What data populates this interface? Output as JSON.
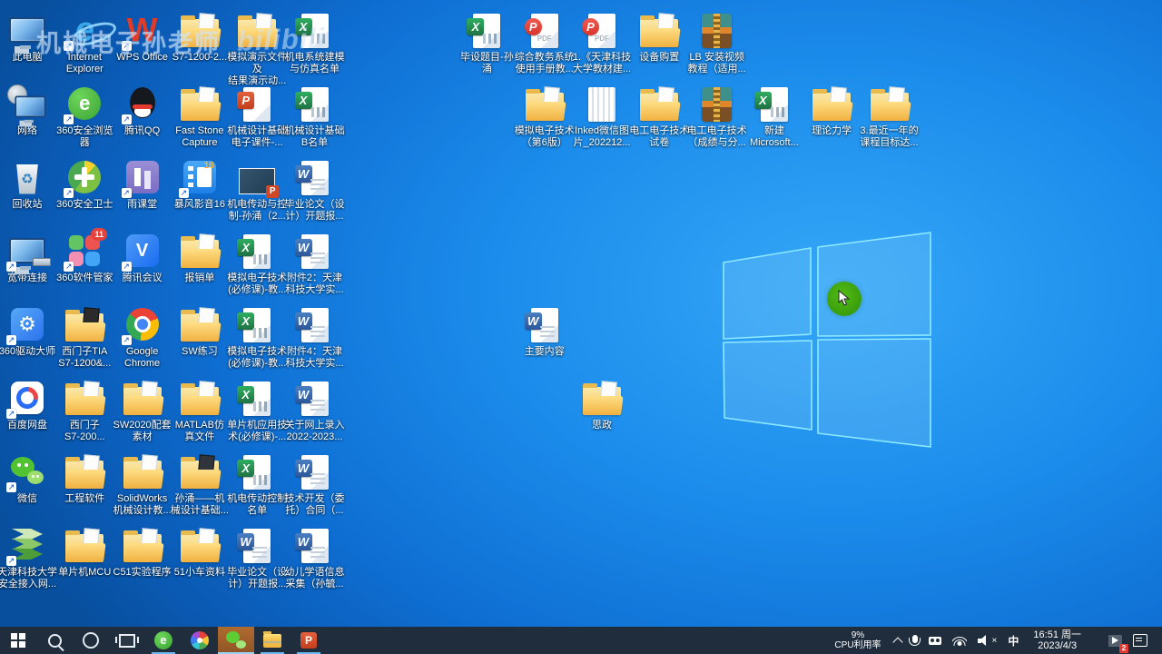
{
  "watermark": {
    "text": "机械电子孙老师",
    "brand": "bilibili"
  },
  "icon_glyphs": {
    "shortcut": "↗",
    "recycle": "♻",
    "ie_letter": "e",
    "wps_letter": "W",
    "browser360_letter": "e",
    "meeting_letter": "V",
    "gear": "⚙",
    "excel_letter": "X",
    "word_letter": "W",
    "ppt_letter": "P",
    "pdf_letter": "P",
    "pdf_label": "PDF",
    "volume_mute_x": "×"
  },
  "desktop": {
    "icons": [
      {
        "id": "this-pc",
        "label": "此电脑",
        "type": "pc",
        "col": 0,
        "row": 0
      },
      {
        "id": "internet-explorer",
        "label": "Internet\nExplorer",
        "type": "ie",
        "col": 1,
        "row": 0,
        "shortcut": true
      },
      {
        "id": "wps-office",
        "label": "WPS Office",
        "type": "wps",
        "col": 2,
        "row": 0,
        "shortcut": true
      },
      {
        "id": "s7-1200-folder",
        "label": "S7-1200-2...",
        "type": "folder",
        "col": 3,
        "row": 0
      },
      {
        "id": "demo-files-folder",
        "label": "模拟演示文件及\n结果演示动...",
        "type": "folder",
        "col": 4,
        "row": 0
      },
      {
        "id": "jd-modeling-roster",
        "label": "机电系统建模\n与仿真名单",
        "type": "excel",
        "col": 5,
        "row": 0
      },
      {
        "id": "bishe-topic",
        "label": "毕设题目-孙\n涌",
        "type": "excel",
        "col": 8,
        "row": 0
      },
      {
        "id": "jiaowu-manual",
        "label": "综合教务系统\n使用手册教...",
        "type": "pdf",
        "col": 9,
        "row": 0
      },
      {
        "id": "tust-textbook",
        "label": "1.《天津科技\n大学教材建...",
        "type": "pdf",
        "col": 10,
        "row": 0
      },
      {
        "id": "equipment-purchase",
        "label": "设备购置",
        "type": "folder",
        "col": 11,
        "row": 0
      },
      {
        "id": "lb-install-video",
        "label": "LB 安装视频\n教程（适用...",
        "type": "rar",
        "col": 12,
        "row": 0
      },
      {
        "id": "network",
        "label": "网络",
        "type": "network",
        "col": 0,
        "row": 1
      },
      {
        "id": "360-browser",
        "label": "360安全浏览\n器",
        "type": "s360se",
        "col": 1,
        "row": 1,
        "shortcut": true
      },
      {
        "id": "tencent-qq",
        "label": "腾讯QQ",
        "type": "qq",
        "col": 2,
        "row": 1,
        "shortcut": true
      },
      {
        "id": "faststone-capture",
        "label": "Fast Stone\nCapture",
        "type": "folder",
        "col": 3,
        "row": 1
      },
      {
        "id": "jixie-sheji-ppt",
        "label": "机械设计基础\n电子课件-...",
        "type": "ppt",
        "col": 4,
        "row": 1
      },
      {
        "id": "jixie-sheji-roster",
        "label": "机械设计基础\nB名单",
        "type": "excel",
        "col": 5,
        "row": 1
      },
      {
        "id": "moni-dianzi-6",
        "label": "模拟电子技术\n（第6版）",
        "type": "folder",
        "col": 9,
        "row": 1
      },
      {
        "id": "inked-wechat-pic",
        "label": "Inked微信图\n片_202212...",
        "type": "image",
        "col": 10,
        "row": 1
      },
      {
        "id": "dg-dz-exam",
        "label": "电工电子技术\n试卷",
        "type": "folder",
        "col": 11,
        "row": 1
      },
      {
        "id": "dg-dz-grades",
        "label": "电工电子技术\n（成绩与分...",
        "type": "rar",
        "col": 12,
        "row": 1
      },
      {
        "id": "new-excel",
        "label": "新建\nMicrosoft...",
        "type": "excel",
        "col": 13,
        "row": 1
      },
      {
        "id": "lilun-lixue",
        "label": "理论力学",
        "type": "folder",
        "col": 14,
        "row": 1
      },
      {
        "id": "course-target",
        "label": "3.最近一年的\n课程目标达...",
        "type": "folder",
        "col": 15,
        "row": 1
      },
      {
        "id": "recycle-bin",
        "label": "回收站",
        "type": "recycle",
        "col": 0,
        "row": 2
      },
      {
        "id": "360-safe",
        "label": "360安全卫士",
        "type": "s360safe",
        "col": 1,
        "row": 2,
        "shortcut": true
      },
      {
        "id": "yuketang",
        "label": "雨课堂",
        "type": "yuketang",
        "col": 2,
        "row": 2,
        "shortcut": true
      },
      {
        "id": "baofeng-16",
        "label": "暴风影音16",
        "type": "baofeng",
        "col": 3,
        "row": 2,
        "shortcut": true,
        "icon_text": "16"
      },
      {
        "id": "jd-chuan-dong-ppt",
        "label": "机电传动与控\n制-孙涌（2...",
        "type": "pptimg",
        "col": 4,
        "row": 2
      },
      {
        "id": "biye-lunwen-1",
        "label": "毕业论文（设\n计）开题报...",
        "type": "word",
        "col": 5,
        "row": 2
      },
      {
        "id": "dialup",
        "label": "宽带连接",
        "type": "dialup",
        "col": 0,
        "row": 3,
        "shortcut": true
      },
      {
        "id": "360-software",
        "label": "360软件管家",
        "type": "s360sw",
        "col": 1,
        "row": 3,
        "shortcut": true,
        "badge": "11"
      },
      {
        "id": "tencent-meeting",
        "label": "腾讯会议",
        "type": "meeting",
        "col": 2,
        "row": 3,
        "shortcut": true
      },
      {
        "id": "baoxiaodan",
        "label": "报销单",
        "type": "folder",
        "col": 3,
        "row": 3
      },
      {
        "id": "moni-dianzi-bixiu2",
        "label": "模拟电子技术\n(必修课)-教...",
        "type": "excel",
        "col": 4,
        "row": 3
      },
      {
        "id": "fujian-2",
        "label": "附件2：天津\n科技大学实...",
        "type": "word",
        "col": 5,
        "row": 3
      },
      {
        "id": "360-driver",
        "label": "360驱动大师",
        "type": "driver360",
        "col": 0,
        "row": 4,
        "shortcut": true
      },
      {
        "id": "siemens-tia",
        "label": "西门子TIA\nS7-1200&...",
        "type": "folder",
        "col": 1,
        "row": 4,
        "variant": "tia"
      },
      {
        "id": "google-chrome",
        "label": "Google\nChrome",
        "type": "chrome",
        "col": 2,
        "row": 4,
        "shortcut": true
      },
      {
        "id": "sw-lianxi",
        "label": "SW练习",
        "type": "folder",
        "col": 3,
        "row": 4
      },
      {
        "id": "moni-dianzi-bixiu4",
        "label": "模拟电子技术\n(必修课)-教...",
        "type": "excel",
        "col": 4,
        "row": 4
      },
      {
        "id": "fujian-4",
        "label": "附件4：天津\n科技大学实...",
        "type": "word",
        "col": 5,
        "row": 4
      },
      {
        "id": "zhuyao-neirong",
        "label": "主要内容",
        "type": "word",
        "col": 9,
        "row": 4
      },
      {
        "id": "baidu-netdisk",
        "label": "百度网盘",
        "type": "baidu",
        "col": 0,
        "row": 5,
        "shortcut": true
      },
      {
        "id": "siemens-s7-200",
        "label": "西门子\nS7-200...",
        "type": "folder",
        "col": 1,
        "row": 5
      },
      {
        "id": "sw2020-material",
        "label": "SW2020配套\n素材",
        "type": "folder",
        "col": 2,
        "row": 5
      },
      {
        "id": "matlab-sim",
        "label": "MATLAB仿\n真文件",
        "type": "folder",
        "col": 3,
        "row": 5
      },
      {
        "id": "danpianji-bixiu",
        "label": "单片机应用技\n术(必修课)-...",
        "type": "excel",
        "col": 4,
        "row": 5
      },
      {
        "id": "wangshang-luru",
        "label": "关于网上录入\n2022-2023...",
        "type": "word",
        "col": 5,
        "row": 5
      },
      {
        "id": "sizheng",
        "label": "思政",
        "type": "folder",
        "col": 10,
        "row": 5
      },
      {
        "id": "wechat",
        "label": "微信",
        "type": "wechat",
        "col": 0,
        "row": 6,
        "shortcut": true
      },
      {
        "id": "gongcheng-soft",
        "label": "工程软件",
        "type": "folder",
        "col": 1,
        "row": 6
      },
      {
        "id": "solidworks-jiao",
        "label": "SolidWorks\n机械设计教...",
        "type": "folder",
        "col": 2,
        "row": 6
      },
      {
        "id": "sunyong-jixie",
        "label": "孙涌——机\n械设计基础...",
        "type": "folder",
        "col": 3,
        "row": 6,
        "variant": "dark"
      },
      {
        "id": "jd-cd-roster",
        "label": "机电传动控制\n名单",
        "type": "excel",
        "col": 4,
        "row": 6
      },
      {
        "id": "jishu-kaifa",
        "label": "技术开发（委\n托）合同（...",
        "type": "word",
        "col": 5,
        "row": 6
      },
      {
        "id": "tust-vpn",
        "label": "天津科技大学\n安全接入网...",
        "type": "vpn",
        "col": 0,
        "row": 7,
        "shortcut": true
      },
      {
        "id": "danpianji-mcu",
        "label": "单片机MCU",
        "type": "folder",
        "col": 1,
        "row": 7
      },
      {
        "id": "c51-experiment",
        "label": "C51实验程序",
        "type": "folder",
        "col": 2,
        "row": 7
      },
      {
        "id": "51-car-data",
        "label": "51小车资料",
        "type": "folder",
        "col": 3,
        "row": 7
      },
      {
        "id": "biye-lunwen-2",
        "label": "毕业论文（设\n计）开题报...",
        "type": "word",
        "col": 4,
        "row": 7
      },
      {
        "id": "youer-xueyu",
        "label": "幼儿学语信息\n采集（孙毓...",
        "type": "word",
        "col": 5,
        "row": 7
      }
    ]
  },
  "taskbar": {
    "items": [
      {
        "id": "start",
        "icon": "windows"
      },
      {
        "id": "search",
        "icon": "search"
      },
      {
        "id": "cortana",
        "icon": "cortana"
      },
      {
        "id": "task-view",
        "icon": "taskview"
      },
      {
        "id": "360-browser",
        "icon": "s360se",
        "running": true
      },
      {
        "id": "colorful-browser",
        "icon": "pinwheel"
      },
      {
        "id": "wechat",
        "icon": "wechat",
        "running": true,
        "active": true
      },
      {
        "id": "file-explorer",
        "icon": "explorer",
        "running": true
      },
      {
        "id": "powerpoint",
        "icon": "ppt",
        "running": true
      }
    ],
    "tray": {
      "cpu_value": "9%",
      "cpu_label": "CPU利用率",
      "ime_label": "中",
      "clock_time": "16:51 周一",
      "clock_date": "2023/4/3",
      "recorder_badge": "2"
    }
  }
}
